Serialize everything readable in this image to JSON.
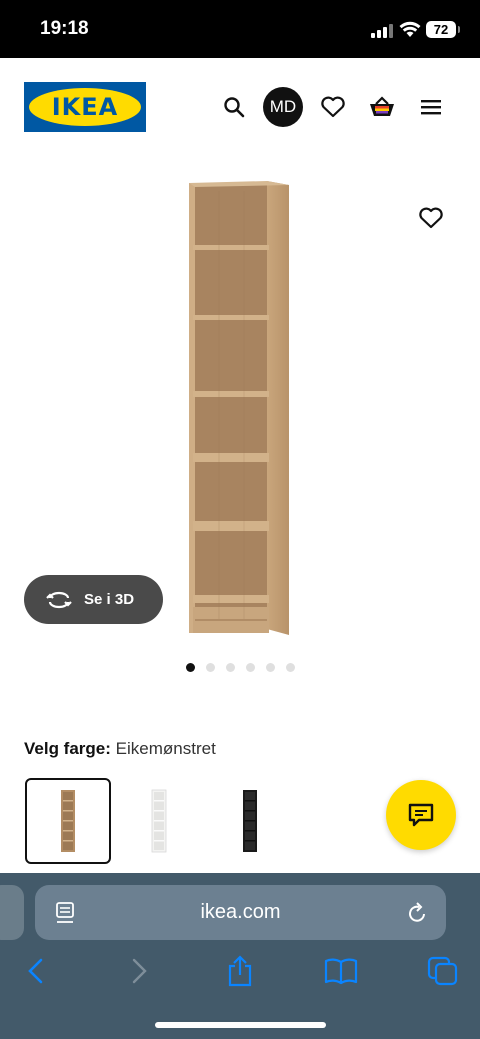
{
  "status": {
    "time": "19:18",
    "battery": "72"
  },
  "header": {
    "logo_text": "IKEA",
    "avatar_initials": "MD",
    "icons": [
      "search-icon",
      "heart-icon",
      "basket-icon",
      "menu-icon"
    ]
  },
  "gallery": {
    "view_3d_label": "Se i 3D",
    "image_count": 6,
    "active_index": 0
  },
  "color_picker": {
    "label": "Velg farge:",
    "selected": "Eikemønstret",
    "swatches": [
      "oak",
      "white",
      "black"
    ]
  },
  "browser": {
    "url": "ikea.com"
  },
  "colors": {
    "brand_blue": "#0058a3",
    "brand_yellow": "#ffdb00",
    "toolbar": "#435a6a",
    "accent_link": "#0a84ff"
  }
}
